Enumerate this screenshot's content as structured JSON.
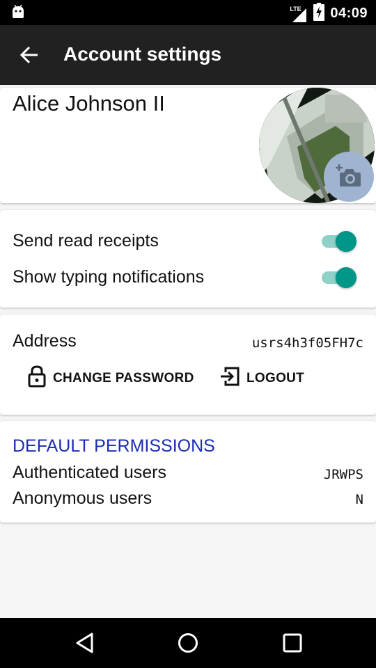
{
  "status_bar": {
    "time": "04:09",
    "network": "LTE",
    "icons": [
      "android-icon",
      "signal-icon",
      "battery-charging-icon"
    ]
  },
  "app_bar": {
    "title": "Account settings",
    "back_icon": "arrow-back-icon"
  },
  "profile": {
    "name": "Alice Johnson II",
    "camera_icon": "add-photo-icon"
  },
  "settings": {
    "send_read_receipts": {
      "label": "Send read receipts",
      "enabled": true
    },
    "show_typing_notifications": {
      "label": "Show typing notifications",
      "enabled": true
    }
  },
  "account": {
    "address_label": "Address",
    "address_value": "usrs4h3f05FH7c",
    "change_password_label": "CHANGE PASSWORD",
    "logout_label": "LOGOUT"
  },
  "permissions": {
    "header": "DEFAULT PERMISSIONS",
    "authenticated_label": "Authenticated users",
    "authenticated_value": "JRWPS",
    "anonymous_label": "Anonymous users",
    "anonymous_value": "N"
  },
  "nav_bar": {
    "icons": [
      "back-triangle-icon",
      "home-circle-icon",
      "recents-square-icon"
    ]
  },
  "colors": {
    "app_bar": "#212121",
    "toggle_on": "#009688",
    "toggle_track": "#8fd1c8",
    "permission_header": "#1a2db3",
    "camera_button": "#9fb4d0"
  }
}
